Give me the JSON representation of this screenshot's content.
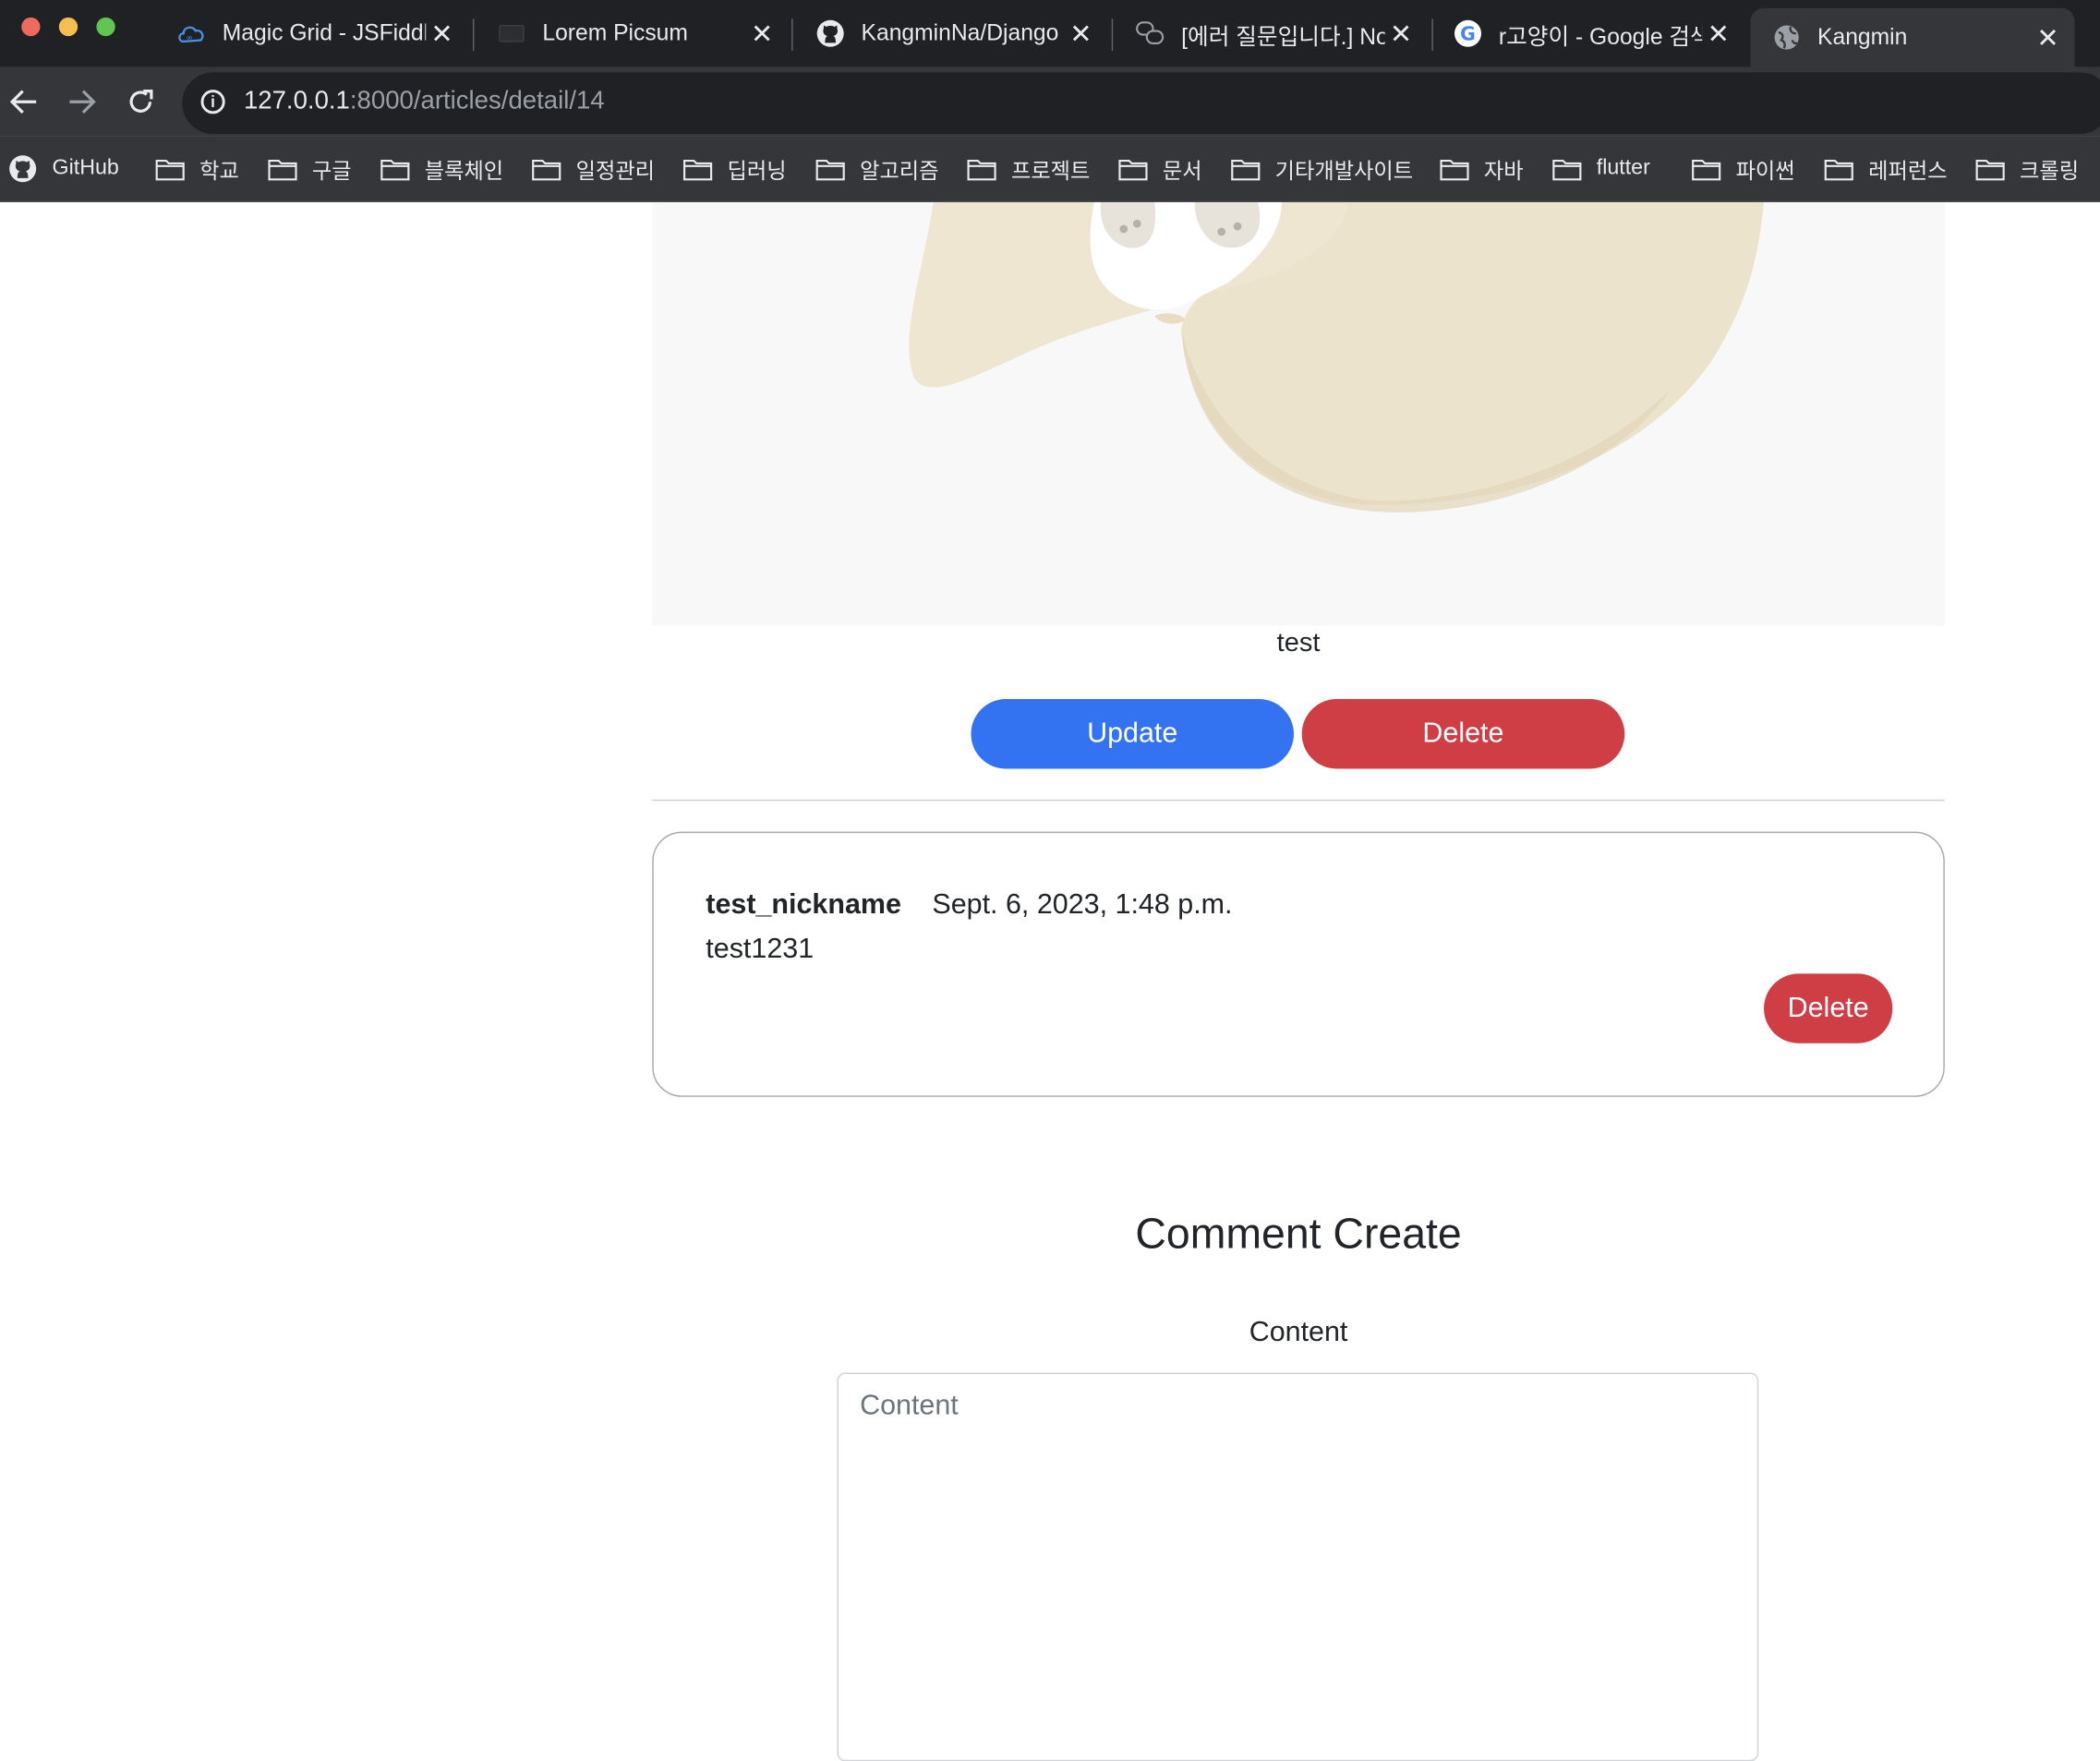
{
  "tabs": [
    {
      "title": "Magic Grid - JSFiddle",
      "icon": "jsfiddle-icon"
    },
    {
      "title": "Lorem Picsum",
      "icon": "picsum-icon"
    },
    {
      "title": "KangminNa/Django",
      "icon": "github-icon"
    },
    {
      "title": "[에러 질문입니다.] No",
      "icon": "chat-icon"
    },
    {
      "title": "r고양이 - Google 검색",
      "icon": "google-icon"
    },
    {
      "title": "Kangmin",
      "icon": "globe-icon",
      "active": true
    }
  ],
  "address_bar": {
    "host": "127.0.0.1",
    "path": ":8000/articles/detail/14"
  },
  "bookmarks": [
    "GitHub",
    "학교",
    "구글",
    "블록체인",
    "일정관리",
    "딥러닝",
    "알고리즘",
    "프로젝트",
    "문서",
    "기타개발사이트",
    "자바",
    "flutter",
    "파이썬",
    "레퍼런스",
    "크롤링"
  ],
  "article": {
    "content": "test",
    "update_label": "Update",
    "delete_label": "Delete"
  },
  "comment": {
    "nickname": "test_nickname",
    "date": "Sept. 6, 2023, 1:48 p.m.",
    "text": "test1231",
    "delete_label": "Delete"
  },
  "comment_form": {
    "heading": "Comment Create",
    "label": "Content",
    "placeholder": "Content"
  },
  "colors": {
    "primary": "#3373f2",
    "danger": "#cf3d45",
    "tab_strip": "#202124",
    "toolbar": "#35363a"
  }
}
